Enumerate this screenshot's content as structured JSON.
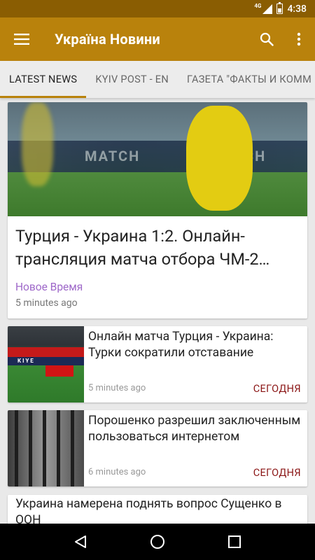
{
  "status_bar": {
    "network": "4G",
    "time": "4:38"
  },
  "app_bar": {
    "title": "Україна Новини"
  },
  "tabs": [
    {
      "label": "LATEST NEWS",
      "active": true
    },
    {
      "label": "KYIV POST - EN",
      "active": false
    },
    {
      "label": "ГАЗЕТА \"ФАКТЫ И КОММ",
      "active": false
    }
  ],
  "feed": {
    "hero": {
      "title": "Турция - Украина 1:2. Онлайн-трансляция матча отбора ЧМ-2…",
      "source": "Новое Время",
      "time": "5 minutes ago"
    },
    "items": [
      {
        "title": "Онлайн матча Турция - Украина: Турки сократили отставание",
        "time": "5 minutes ago",
        "badge": "СЕГОДНЯ"
      },
      {
        "title": "Порошенко разрешил заключенным пользоваться интернетом",
        "time": "6 minutes ago",
        "badge": "СЕГОДНЯ"
      },
      {
        "title": "Украина намерена поднять вопрос Сущенко в ООН"
      }
    ]
  },
  "colors": {
    "accent": "#b9820c",
    "status_bar": "#8a5d02",
    "source": "#9e68c9",
    "badge": "#8a1414"
  },
  "icons": {
    "menu": "hamburger-icon",
    "search": "search-icon",
    "overflow": "more-vert-icon",
    "back": "back-icon",
    "home": "home-icon",
    "recents": "recents-icon"
  }
}
